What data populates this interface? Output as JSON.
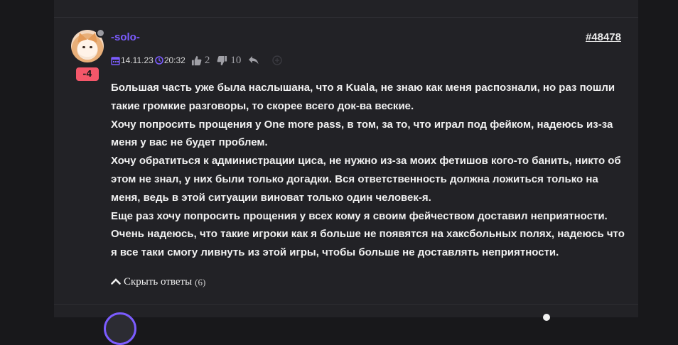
{
  "post": {
    "username": "-solo-",
    "post_id": "#48478",
    "reputation": "-4",
    "date": "14.11.23",
    "time": "20:32",
    "likes": "2",
    "dislikes": "10",
    "accent_color": "#7b5cff",
    "badge_color": "#f4576a",
    "body": [
      "Большая часть уже была наслышана, что я Kuala, не знаю как меня распознали, но раз пошли такие громкие разговоры, то скорее всего док-ва веские.",
      "Хочу попросить прощения у One more pass, в том, за то, что играл под фейком, надеюсь из-за меня у вас не будет проблем.",
      "Хочу обратиться к администрации циса, не нужно из-за моих фетишов кого-то банить, никто об этом не знал, у них были только догадки. Вся ответственность должна ложиться только на меня, ведь в этой ситуации виноват только один человек-я.",
      "Еще раз хочу попросить прощения у всех кому я своим фейчеством доставил неприятности.",
      "Очень надеюсь, что такие игроки как я больше не появятся на хаксбольных полях, надеюсь что я все таки смогу ливнуть из этой игры, чтобы больше не доставлять неприятности."
    ]
  },
  "replies_toggle": {
    "label": "Скрыть ответы",
    "count": "(6)"
  },
  "icons": [
    "calendar-icon",
    "clock-icon",
    "thumbs-up-icon",
    "thumbs-down-icon",
    "reply-icon",
    "add-reaction-icon",
    "chevron-up-icon"
  ]
}
